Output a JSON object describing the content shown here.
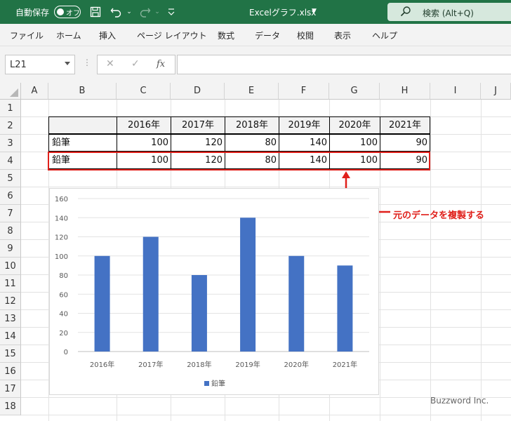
{
  "titlebar": {
    "autosave_label": "自動保存",
    "autosave_state": "オフ",
    "filename": "Excelグラフ.xlsx",
    "search_label": "検索 (Alt+Q)",
    "accent": "#217346"
  },
  "ribbon": {
    "tabs": [
      "ファイル",
      "ホーム",
      "挿入",
      "ページ レイアウト",
      "数式",
      "データ",
      "校閲",
      "表示",
      "ヘルプ"
    ]
  },
  "formula_bar": {
    "name_box": "L21",
    "fx_label": "fx",
    "formula": ""
  },
  "columns": [
    "A",
    "B",
    "C",
    "D",
    "E",
    "F",
    "G",
    "H",
    "I",
    "J"
  ],
  "rows": [
    "1",
    "2",
    "3",
    "4",
    "5",
    "6",
    "7",
    "8",
    "9",
    "10",
    "11",
    "12",
    "13",
    "14",
    "15",
    "16",
    "17",
    "18"
  ],
  "table": {
    "headers": [
      "",
      "2016年",
      "2017年",
      "2018年",
      "2019年",
      "2020年",
      "2021年"
    ],
    "row3": [
      "鉛筆",
      "100",
      "120",
      "80",
      "140",
      "100",
      "90"
    ],
    "row4": [
      "鉛筆",
      "100",
      "120",
      "80",
      "140",
      "100",
      "90"
    ]
  },
  "chart_data": {
    "type": "bar",
    "categories": [
      "2016年",
      "2017年",
      "2018年",
      "2019年",
      "2020年",
      "2021年"
    ],
    "series": [
      {
        "name": "鉛筆",
        "values": [
          100,
          120,
          80,
          140,
          100,
          90
        ],
        "color": "#4472c4"
      }
    ],
    "yticks": [
      "0",
      "20",
      "40",
      "60",
      "80",
      "100",
      "120",
      "140",
      "160"
    ],
    "ylim": [
      0,
      160
    ],
    "legend": "bottom",
    "grid": true
  },
  "annotation": {
    "text": "元のデータを複製する",
    "color": "#e0201b"
  },
  "watermark": "Buzzword Inc."
}
